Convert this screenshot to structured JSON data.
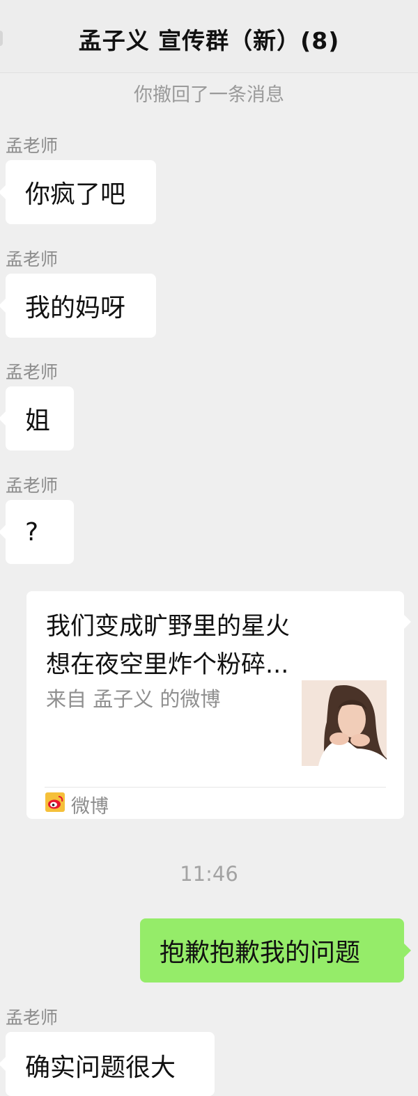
{
  "header": {
    "title": "孟子义 宣传群（新）(8)"
  },
  "system": {
    "recalled": "你撤回了一条消息",
    "time": "11:46"
  },
  "messages": [
    {
      "sender": "孟老师",
      "text": "你疯了吧"
    },
    {
      "sender": "孟老师",
      "text": "我的妈呀"
    },
    {
      "sender": "孟老师",
      "text": "姐"
    },
    {
      "sender": "孟老师",
      "text": "?"
    }
  ],
  "share_card": {
    "title_line1": "我们变成旷野里的星火",
    "title_line2": "想在夜空里炸个粉碎...",
    "source": "来自 孟子义 的微博",
    "app_name": "微博",
    "app_icon": "weibo-icon"
  },
  "my_message": {
    "text": "抱歉抱歉我的问题"
  },
  "last_message": {
    "sender": "孟老师",
    "text_partial": "确实问题很大"
  },
  "colors": {
    "background": "#efefef",
    "my_bubble": "#95ec69",
    "other_bubble": "#ffffff"
  }
}
